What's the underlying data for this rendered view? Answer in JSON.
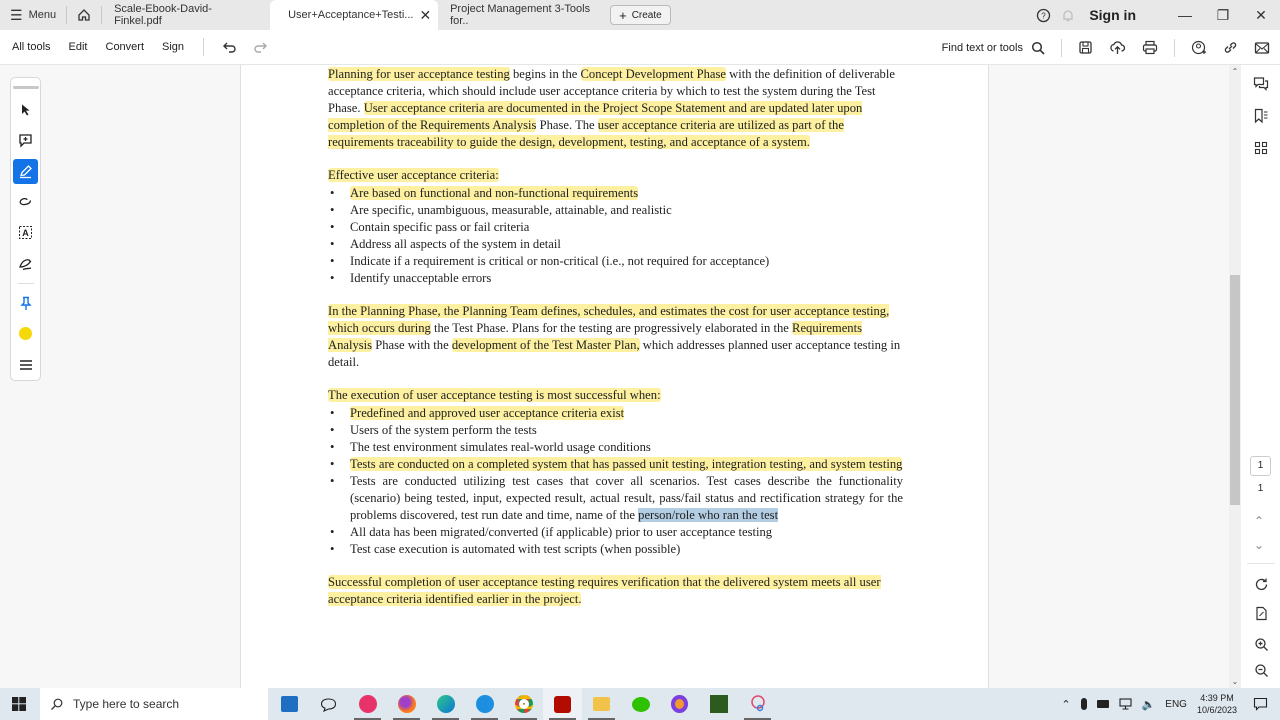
{
  "tabbar": {
    "menu_label": "Menu",
    "tabs": [
      {
        "label": "Scale-Ebook-David-Finkel.pdf",
        "active": false
      },
      {
        "label": "User+Acceptance+Testi...",
        "active": true
      },
      {
        "label": "Project Management 3-Tools for..",
        "active": false
      }
    ],
    "create_label": "Create",
    "signin_label": "Sign in"
  },
  "toolbar": {
    "items": [
      "All tools",
      "Edit",
      "Convert",
      "Sign"
    ],
    "find_label": "Find text or tools"
  },
  "document": {
    "p1": {
      "segments": [
        {
          "text": "Planning for user acceptance testing",
          "hl": true
        },
        {
          "text": " begins in the ",
          "hl": false
        },
        {
          "text": "Concept Development Phase",
          "hl": true
        },
        {
          "text": " with the definition of deliverable acceptance criteria, which should include user acceptance criteria by which to test the system during the Test Phase.  ",
          "hl": false
        },
        {
          "text": "User acceptance criteria are documented in the Project Scope Statement and are updated later upon completion of the Requirements Analysis",
          "hl": true
        },
        {
          "text": " Phase.  The ",
          "hl": false
        },
        {
          "text": "user acceptance criteria are utilized as part of the requirements traceability to guide the design, development, testing, and acceptance of a system.",
          "hl": true
        }
      ]
    },
    "list1_heading": "Effective user acceptance criteria:",
    "list1": [
      {
        "text": "Are based on functional and non-functional requirements",
        "hl": true
      },
      {
        "text": "Are specific, unambiguous, measurable, attainable, and realistic",
        "hl": false
      },
      {
        "text": "Contain specific pass or fail criteria",
        "hl": false
      },
      {
        "text": "Address all aspects of the system in detail",
        "hl": false
      },
      {
        "text": "Indicate if a requirement is critical or non-critical (i.e., not required for acceptance)",
        "hl": false
      },
      {
        "text": "Identify unacceptable errors",
        "hl": false
      }
    ],
    "p2": {
      "segments": [
        {
          "text": "In the Planning Phase, the Planning Team defines, schedules, and estimates the cost for user acceptance testing, which occurs during",
          "hl": true
        },
        {
          "text": " the Test Phase.  Plans for the testing are progressively elaborated in the ",
          "hl": false
        },
        {
          "text": "Requirements Analysis",
          "hl": true
        },
        {
          "text": " Phase with the ",
          "hl": false
        },
        {
          "text": "development of the Test Master Plan,",
          "hl": true
        },
        {
          "text": " which addresses planned user acceptance testing in detail.",
          "hl": false
        }
      ]
    },
    "list2_heading": "The execution of user acceptance testing is most successful when:",
    "list2": [
      {
        "text": "Predefined and approved user acceptance criteria exist",
        "hl": true
      },
      {
        "text": "Users of the system perform the tests",
        "hl": false
      },
      {
        "text": "The test environment simulates real-world usage conditions",
        "hl": false
      },
      {
        "text": "Tests are conducted on a completed system that has passed unit testing, integration testing, and system testing",
        "hl": true
      },
      {
        "text": "Tests are conducted utilizing test cases that cover all scenarios.  Test cases describe the functionality (scenario) being tested, input, expected result, actual result, pass/fail status and rectification strategy for the problems discovered, test run date and time, name of the ",
        "hl": false,
        "selected": "person/role who ran the test"
      },
      {
        "text": "All data has been migrated/converted (if applicable) prior to user acceptance testing",
        "hl": false
      },
      {
        "text": "Test case execution is automated with test scripts (when possible)",
        "hl": false
      }
    ],
    "p3": "Successful completion of user acceptance testing requires verification that the delivered system meets all user acceptance criteria identified earlier in the project."
  },
  "navigation": {
    "current_page": "1",
    "total_pages": "1"
  },
  "taskbar": {
    "search_placeholder": "Type here to search",
    "lang": "ENG",
    "time": "4:39 PM",
    "date": "10/6/2023"
  },
  "colors": {
    "highlight": "#fdf0a0",
    "selection": "#b3cde3",
    "accent": "#1473e6",
    "annot_yellow": "#f5d90a"
  }
}
